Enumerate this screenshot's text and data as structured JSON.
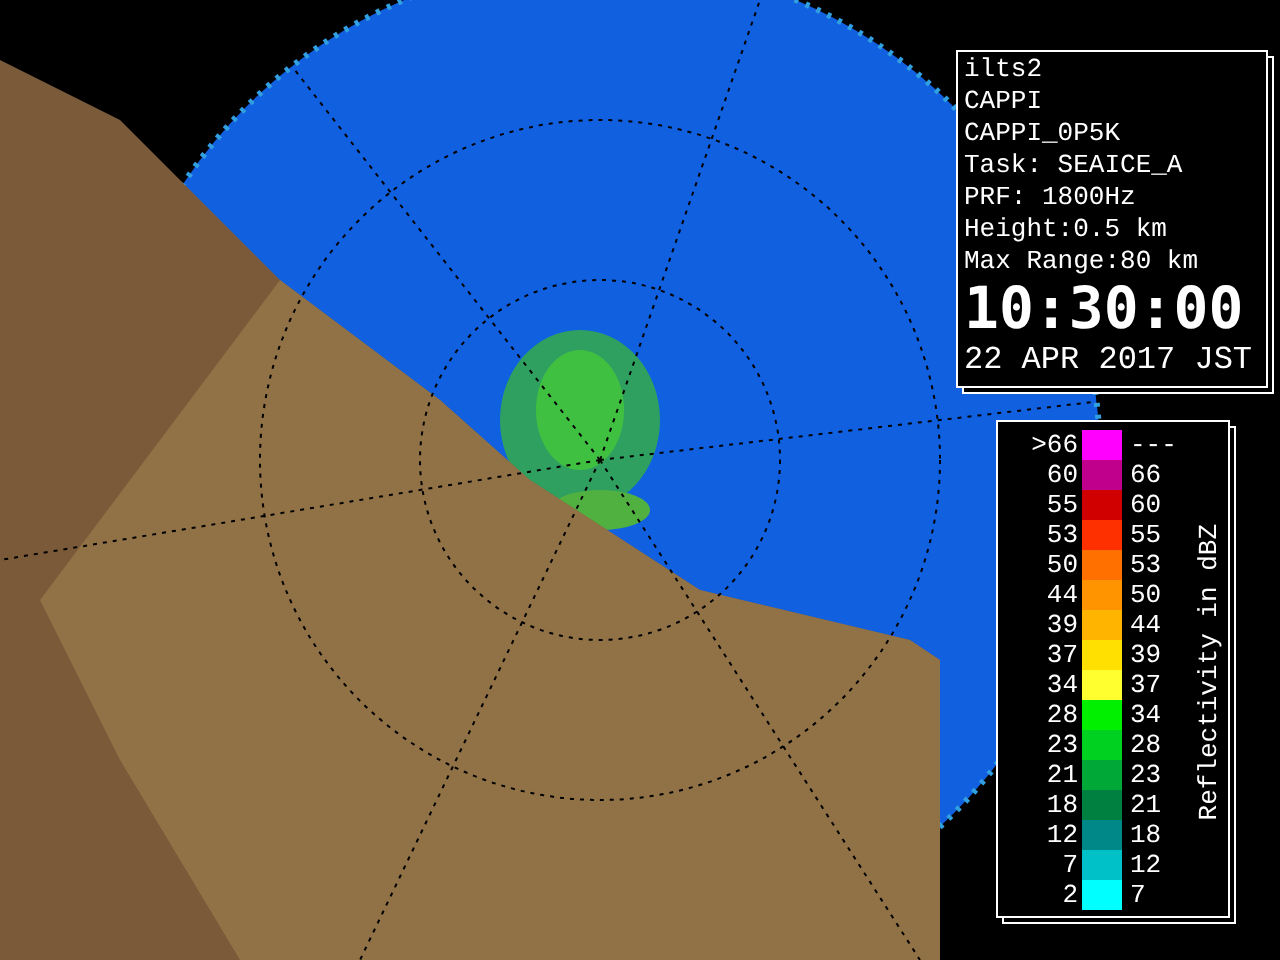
{
  "info_panel": {
    "lines": [
      "ilts2",
      "CAPPI",
      "CAPPI_0P5K",
      "Task: SEAICE_A",
      "PRF: 1800Hz",
      "Height:0.5 km",
      "Max Range:80 km"
    ],
    "time": "10:30:00",
    "date": "22 APR 2017 JST"
  },
  "legend": {
    "title": "Reflectivity in dBZ",
    "rows": [
      {
        "low": ">66",
        "high": "---",
        "color": "#ff00ff"
      },
      {
        "low": "60",
        "high": "66",
        "color": "#c0008c"
      },
      {
        "low": "55",
        "high": "60",
        "color": "#d00000"
      },
      {
        "low": "53",
        "high": "55",
        "color": "#ff3000"
      },
      {
        "low": "50",
        "high": "53",
        "color": "#ff7000"
      },
      {
        "low": "44",
        "high": "50",
        "color": "#ff9400"
      },
      {
        "low": "39",
        "high": "44",
        "color": "#ffb400"
      },
      {
        "low": "37",
        "high": "39",
        "color": "#ffe000"
      },
      {
        "low": "34",
        "high": "37",
        "color": "#ffff30"
      },
      {
        "low": "28",
        "high": "34",
        "color": "#00f000"
      },
      {
        "low": "23",
        "high": "28",
        "color": "#00d020"
      },
      {
        "low": "21",
        "high": "23",
        "color": "#00a838"
      },
      {
        "low": "18",
        "high": "21",
        "color": "#008040"
      },
      {
        "low": "12",
        "high": "18",
        "color": "#008888"
      },
      {
        "low": "7",
        "high": "12",
        "color": "#00c0c8"
      },
      {
        "low": "2",
        "high": "7",
        "color": "#00ffff"
      }
    ]
  }
}
